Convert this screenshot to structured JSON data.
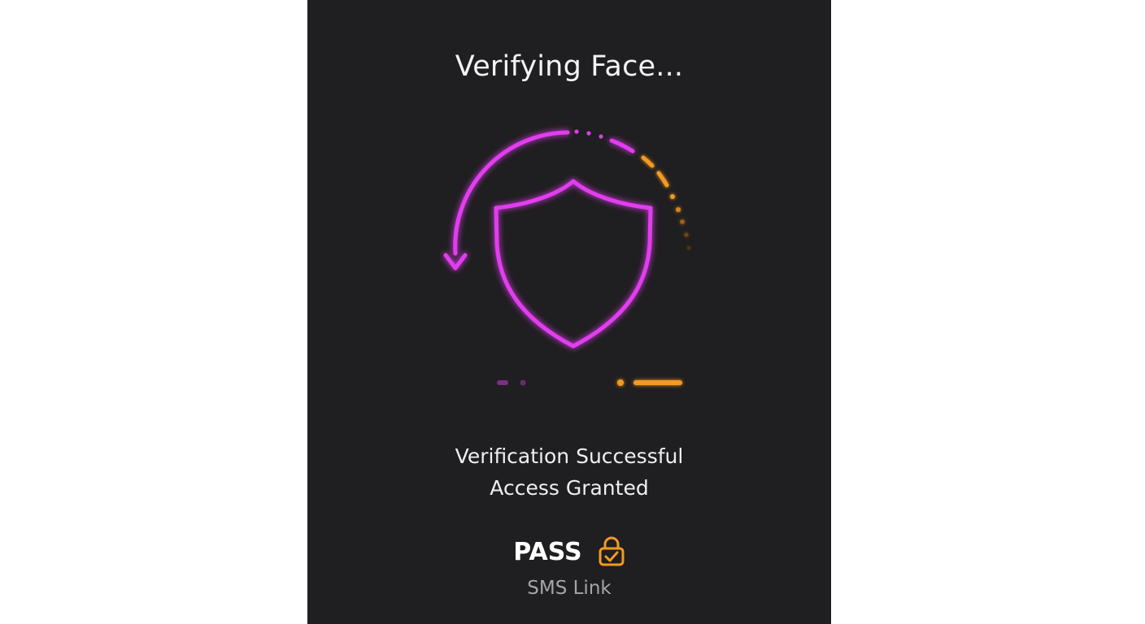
{
  "screen": {
    "title": "Verifying Face...",
    "icon": "shield-icon",
    "status_line1": "Verification Successful",
    "status_line2": "Access Granted",
    "result_label": "PASS",
    "result_icon": "lock-check-icon",
    "method_label": "SMS Link"
  },
  "colors": {
    "background": "#1f1e20",
    "accent_primary": "#e23cf0",
    "accent_secondary": "#f29a22",
    "text_primary": "#f4f4f4",
    "text_secondary": "#a6a6a6"
  }
}
